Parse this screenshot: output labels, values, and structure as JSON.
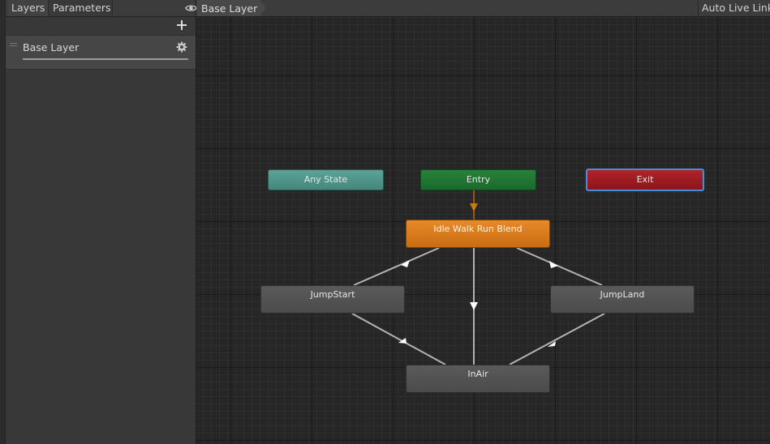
{
  "left_panel": {
    "tabs": [
      {
        "label": "Layers"
      },
      {
        "label": "Parameters"
      }
    ],
    "icons": {
      "visibility": "eye-icon",
      "add": "plus-icon"
    },
    "layers": [
      {
        "name": "Base Layer",
        "settings_icon": "gear-icon"
      }
    ]
  },
  "graph_header": {
    "breadcrumb": "Base Layer",
    "auto_live_link": "Auto Live Link"
  },
  "states": {
    "any_state": "Any State",
    "entry": "Entry",
    "exit": "Exit",
    "idle": "Idle Walk Run Blend",
    "jump_start": "JumpStart",
    "jump_land": "JumpLand",
    "in_air": "InAir"
  },
  "colors": {
    "any_state": "#4f9489",
    "entry": "#217532",
    "exit": "#9e1c22",
    "default_state": "#d77a1c",
    "state": "#525252",
    "selection": "#4a8ed8"
  }
}
